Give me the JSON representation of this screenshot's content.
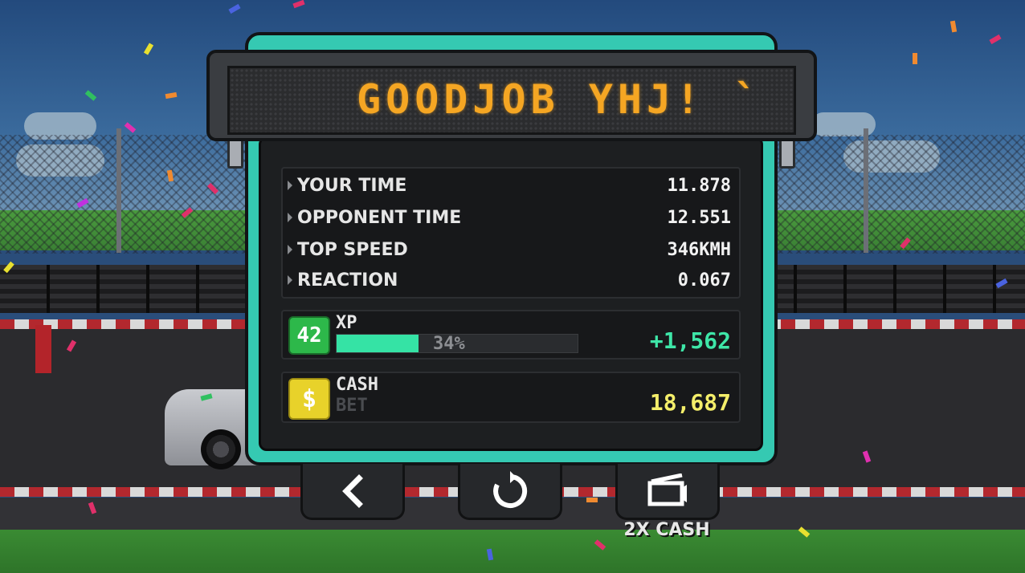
{
  "banner": {
    "text": "GOODJOB YHJ! `"
  },
  "stats": [
    {
      "label": "YOUR TIME",
      "value": "11.878"
    },
    {
      "label": "OPPONENT TIME",
      "value": "12.551"
    },
    {
      "label": "TOP SPEED",
      "value": "346KMH"
    },
    {
      "label": "REACTION",
      "value": "0.067"
    }
  ],
  "xp": {
    "level": "42",
    "label": "XP",
    "progress_percent": 34,
    "progress_text": "34%",
    "gain": "+1,562"
  },
  "cash": {
    "label": "CASH",
    "sub_label": "BET",
    "value": "18,687",
    "icon_glyph": "$"
  },
  "buttons": {
    "back": {
      "icon": "chevron-left-icon",
      "glyph": "‹"
    },
    "restart": {
      "icon": "restart-icon",
      "glyph": "↻"
    },
    "double_cash": {
      "icon": "video-ad-icon",
      "caption": "2X CASH"
    }
  },
  "colors": {
    "panel_accent": "#35c9b2",
    "banner_text": "#f5a623",
    "xp_green": "#35e3a5",
    "cash_yellow": "#f4ee6a",
    "level_badge": "#2db84a"
  }
}
